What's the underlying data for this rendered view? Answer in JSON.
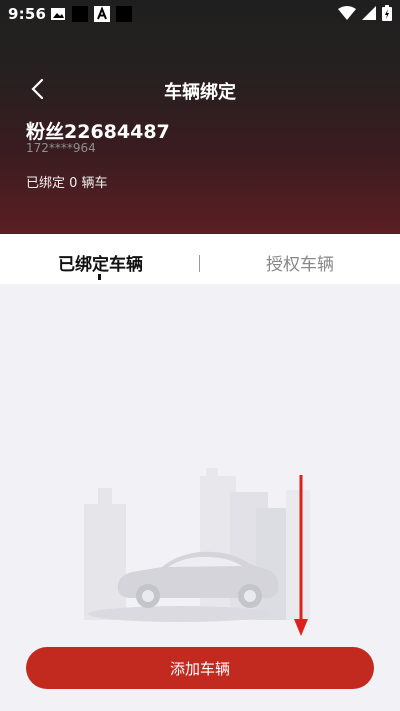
{
  "status_bar": {
    "time": "9:56"
  },
  "header": {
    "title": "车辆绑定",
    "user_name": "粉丝22684487",
    "phone": "172****964",
    "bind_count": "已绑定 0 辆车"
  },
  "tabs": [
    {
      "label": "已绑定车辆",
      "active": true
    },
    {
      "label": "授权车辆",
      "active": false
    }
  ],
  "main": {
    "add_button": "添加车辆"
  },
  "colors": {
    "accent": "#c32a1f",
    "annotation_arrow": "#e0201b"
  }
}
